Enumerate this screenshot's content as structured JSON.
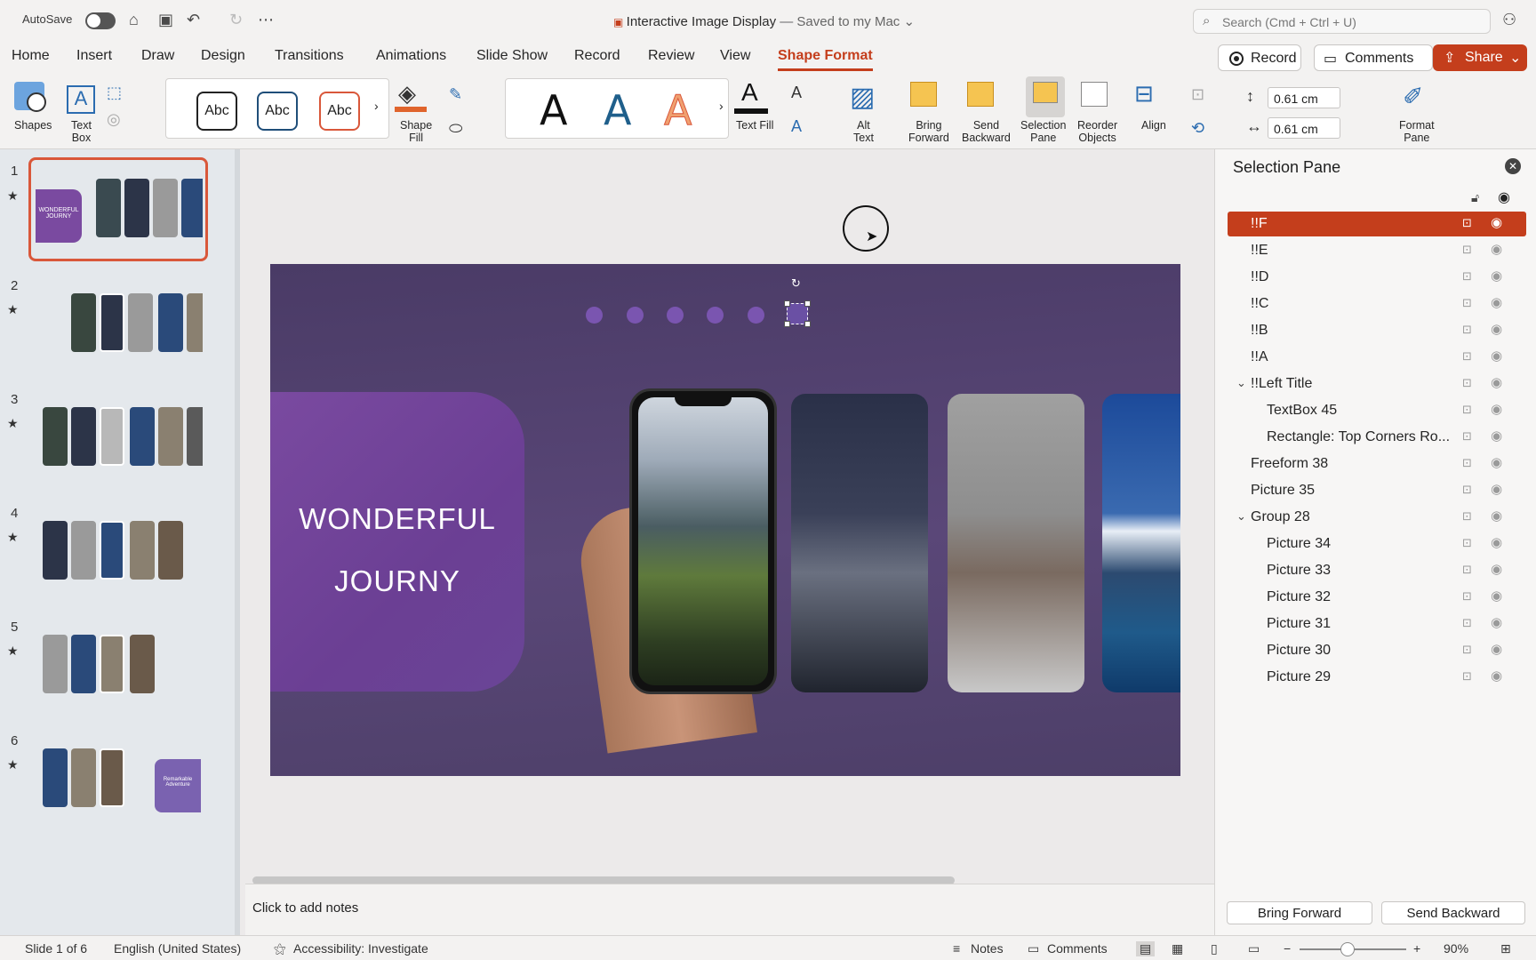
{
  "titlebar": {
    "autosave": "AutoSave",
    "doc_title": "Interactive Image Display",
    "doc_status": " — Saved to my Mac",
    "search_placeholder": "Search (Cmd + Ctrl + U)"
  },
  "tabs": [
    "Home",
    "Insert",
    "Draw",
    "Design",
    "Transitions",
    "Animations",
    "Slide Show",
    "Record",
    "Review",
    "View",
    "Shape Format"
  ],
  "active_tab": "Shape Format",
  "header_buttons": {
    "record": "Record",
    "comments": "Comments",
    "share": "Share"
  },
  "ribbon": {
    "shapes": "Shapes",
    "text_box_1": "Text",
    "text_box_2": "Box",
    "style_abc": [
      "Abc",
      "Abc",
      "Abc"
    ],
    "shape_fill_1": "Shape",
    "shape_fill_2": "Fill",
    "wordart": [
      "A",
      "A",
      "A"
    ],
    "text_fill": "Text Fill",
    "alt_text_1": "Alt",
    "alt_text_2": "Text",
    "bring_forward_1": "Bring",
    "bring_forward_2": "Forward",
    "send_backward_1": "Send",
    "send_backward_2": "Backward",
    "selection_pane_1": "Selection",
    "selection_pane_2": "Pane",
    "reorder_1": "Reorder",
    "reorder_2": "Objects",
    "align": "Align",
    "height": "0.61 cm",
    "width": "0.61 cm",
    "format_pane_1": "Format",
    "format_pane_2": "Pane"
  },
  "thumbnails": [
    {
      "num": "1",
      "star": "★",
      "text": "WONDERFUL JOURNY"
    },
    {
      "num": "2",
      "star": "★"
    },
    {
      "num": "3",
      "star": "★"
    },
    {
      "num": "4",
      "star": "★"
    },
    {
      "num": "5",
      "star": "★"
    },
    {
      "num": "6",
      "star": "★",
      "text": "Remarkable Adventure"
    }
  ],
  "slide": {
    "title_line1": "WONDERFUL",
    "title_line2": "JOURNY"
  },
  "notes_placeholder": "Click to add notes",
  "selection_pane": {
    "title": "Selection Pane",
    "items": [
      {
        "label": "!!F",
        "indent": 0,
        "selected": true
      },
      {
        "label": "!!E",
        "indent": 0
      },
      {
        "label": "!!D",
        "indent": 0
      },
      {
        "label": "!!C",
        "indent": 0
      },
      {
        "label": "!!B",
        "indent": 0
      },
      {
        "label": "!!A",
        "indent": 0
      },
      {
        "label": "!!Left Title",
        "indent": 0,
        "group": true
      },
      {
        "label": "TextBox 45",
        "indent": 1
      },
      {
        "label": "Rectangle: Top Corners Ro...",
        "indent": 1
      },
      {
        "label": "Freeform 38",
        "indent": 0
      },
      {
        "label": "Picture 35",
        "indent": 0
      },
      {
        "label": "Group 28",
        "indent": 0,
        "group": true
      },
      {
        "label": "Picture 34",
        "indent": 1
      },
      {
        "label": "Picture 33",
        "indent": 1
      },
      {
        "label": "Picture 32",
        "indent": 1
      },
      {
        "label": "Picture 31",
        "indent": 1
      },
      {
        "label": "Picture 30",
        "indent": 1
      },
      {
        "label": "Picture 29",
        "indent": 1
      }
    ],
    "bring_forward": "Bring Forward",
    "send_backward": "Send Backward"
  },
  "status": {
    "slide": "Slide 1 of 6",
    "language": "English (United States)",
    "accessibility": "Accessibility: Investigate",
    "notes": "Notes",
    "comments": "Comments",
    "zoom": "90%"
  },
  "colors": {
    "accent": "#c43e1c",
    "slide_bg": "#4f3f6b",
    "card": "#7043a0"
  }
}
